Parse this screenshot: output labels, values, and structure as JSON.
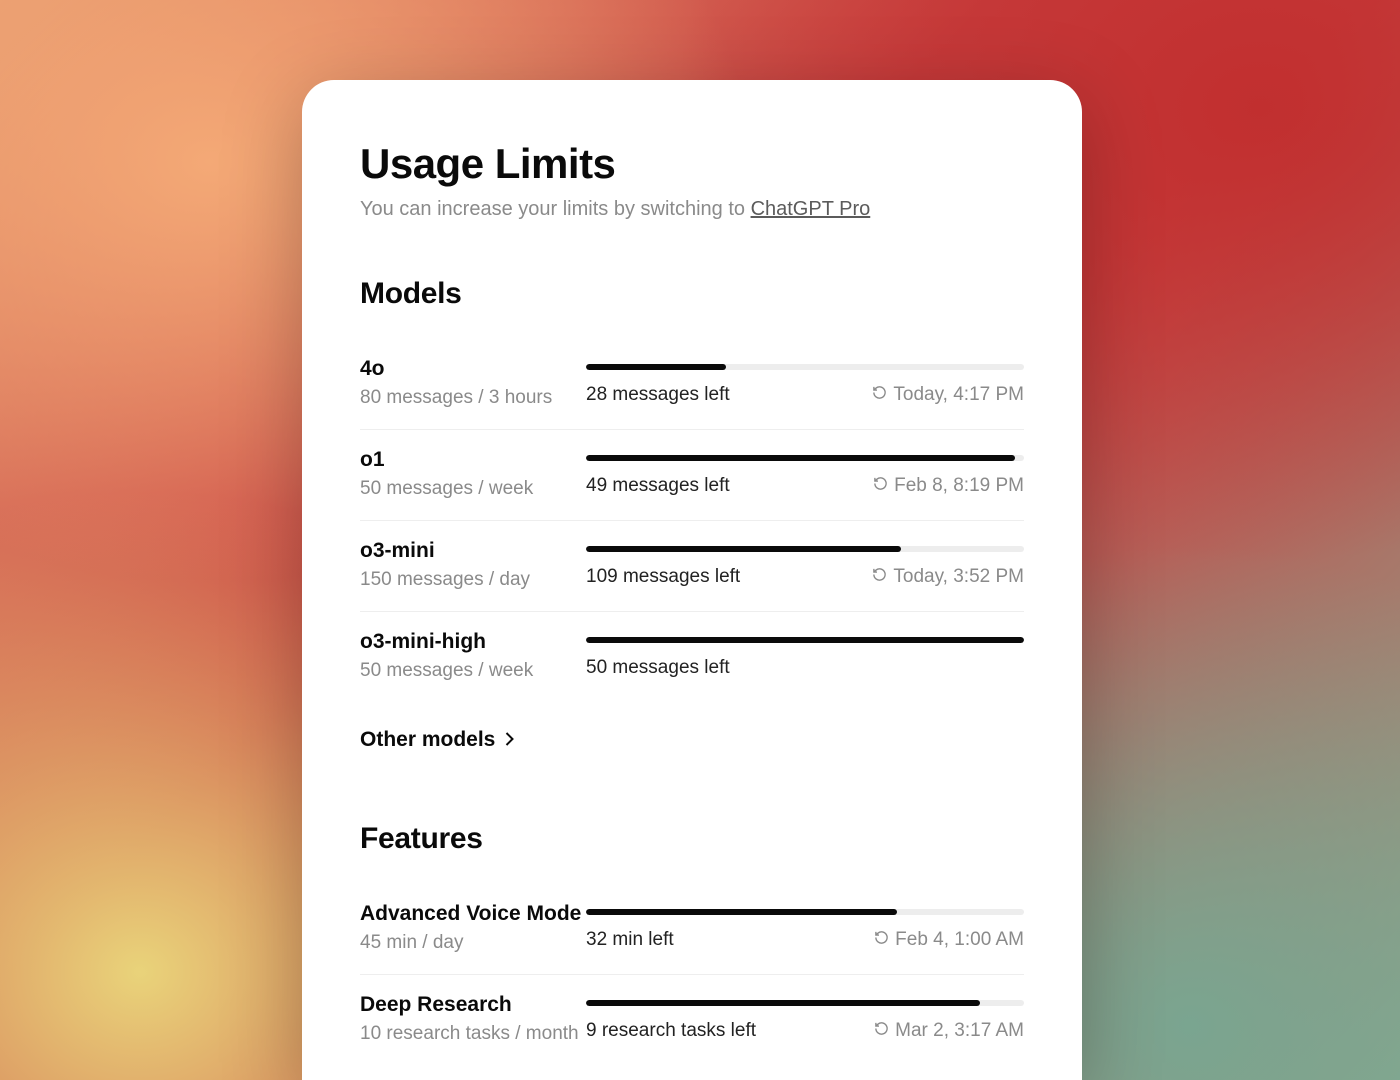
{
  "header": {
    "title": "Usage Limits",
    "subtitle_prefix": "You can increase your limits by switching to ",
    "pro_link_label": "ChatGPT Pro"
  },
  "sections": {
    "models": {
      "title": "Models",
      "other_label": "Other models",
      "items": [
        {
          "name": "4o",
          "quota": "80 messages / 3 hours",
          "remaining": "28 messages left",
          "reset": "Today, 4:17 PM",
          "percent": 32
        },
        {
          "name": "o1",
          "quota": "50 messages / week",
          "remaining": "49 messages left",
          "reset": "Feb 8, 8:19 PM",
          "percent": 98
        },
        {
          "name": "o3-mini",
          "quota": "150 messages / day",
          "remaining": "109 messages left",
          "reset": "Today, 3:52 PM",
          "percent": 72
        },
        {
          "name": "o3-mini-high",
          "quota": "50 messages / week",
          "remaining": "50 messages left",
          "reset": "",
          "percent": 100
        }
      ]
    },
    "features": {
      "title": "Features",
      "items": [
        {
          "name": "Advanced Voice Mode",
          "quota": "45 min / day",
          "remaining": "32 min left",
          "reset": "Feb 4, 1:00 AM",
          "percent": 71
        },
        {
          "name": "Deep Research",
          "quota": "10 research tasks / month",
          "remaining": "9 research tasks left",
          "reset": "Mar 2, 3:17 AM",
          "percent": 90
        }
      ]
    }
  }
}
